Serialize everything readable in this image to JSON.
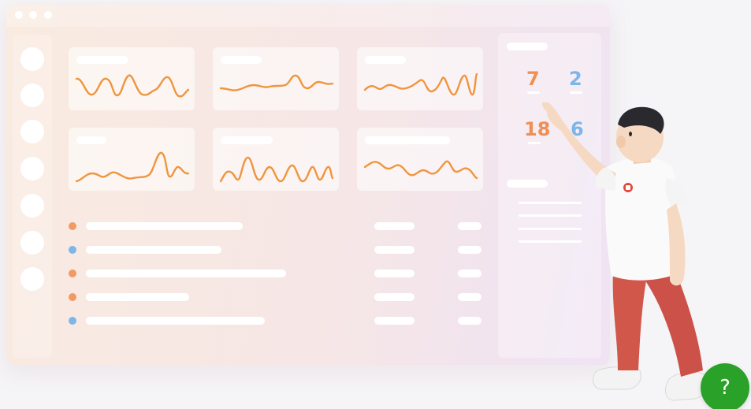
{
  "dashboard": {
    "sidebar_buttons": [
      "nav-1",
      "nav-2",
      "nav-3",
      "nav-4",
      "nav-5",
      "nav-6",
      "nav-7"
    ],
    "cards": [
      {
        "id": "card-1"
      },
      {
        "id": "card-2"
      },
      {
        "id": "card-3"
      },
      {
        "id": "card-4"
      },
      {
        "id": "card-5"
      },
      {
        "id": "card-6"
      }
    ],
    "list_rows": [
      {
        "dot_color": "#f29a63"
      },
      {
        "dot_color": "#7fb6ea"
      },
      {
        "dot_color": "#f29a63"
      },
      {
        "dot_color": "#f29a63"
      },
      {
        "dot_color": "#7fb6ea"
      }
    ],
    "stats": {
      "n1": "7",
      "n2": "2",
      "n3": "18",
      "n4": "6"
    }
  },
  "help_button": {
    "label": "?"
  },
  "colors": {
    "accent_orange": "#f08f55",
    "accent_blue": "#7db4ea",
    "help_green": "#2aa22a"
  },
  "icons": {
    "help": "question-mark-icon",
    "character_badge": "badge-icon"
  }
}
